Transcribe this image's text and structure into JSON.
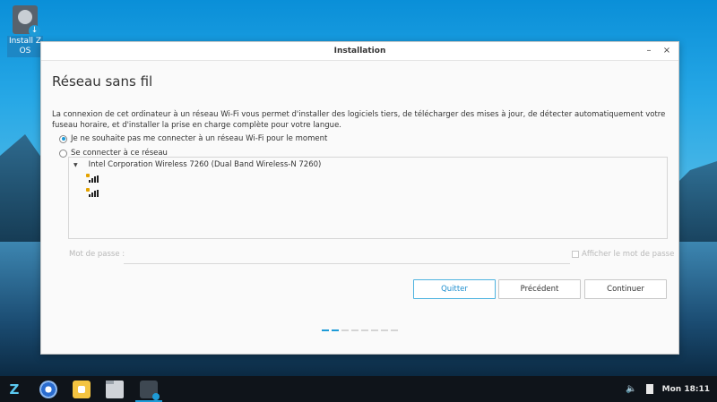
{
  "desktop": {
    "icon_label": "Install Z\nOS"
  },
  "window": {
    "title": "Installation",
    "minimize_glyph": "–",
    "close_glyph": "×",
    "heading": "Réseau sans fil",
    "description": "La connexion de cet ordinateur à un réseau Wi-Fi vous permet d'installer des logiciels tiers, de télécharger des mises à jour, de détecter automatiquement votre fuseau horaire, et d'installer la prise en charge complète pour votre langue.",
    "options": {
      "no_connect": "Je ne souhaite pas me connecter à un réseau Wi-Fi pour le moment",
      "connect": "Se connecter à ce réseau"
    },
    "network_list": {
      "adapter": "Intel Corporation Wireless 7260 (Dual Band Wireless-N 7260)",
      "networks": [
        {
          "icon": "wifi-secure-icon"
        },
        {
          "icon": "wifi-secure-icon"
        }
      ]
    },
    "password": {
      "label": "Mot de passe :",
      "value": "",
      "show_label": "Afficher le mot de passe"
    },
    "buttons": {
      "quit": "Quitter",
      "previous": "Précédent",
      "continue": "Continuer"
    },
    "progress": {
      "total_steps": 8,
      "completed_steps": 2
    }
  },
  "taskbar": {
    "logo_glyph": "Z",
    "volume_glyph": "🔈",
    "clock": "Mon 18:11"
  },
  "colors": {
    "accent": "#1e9bd7",
    "taskbar": "#0f141a"
  }
}
